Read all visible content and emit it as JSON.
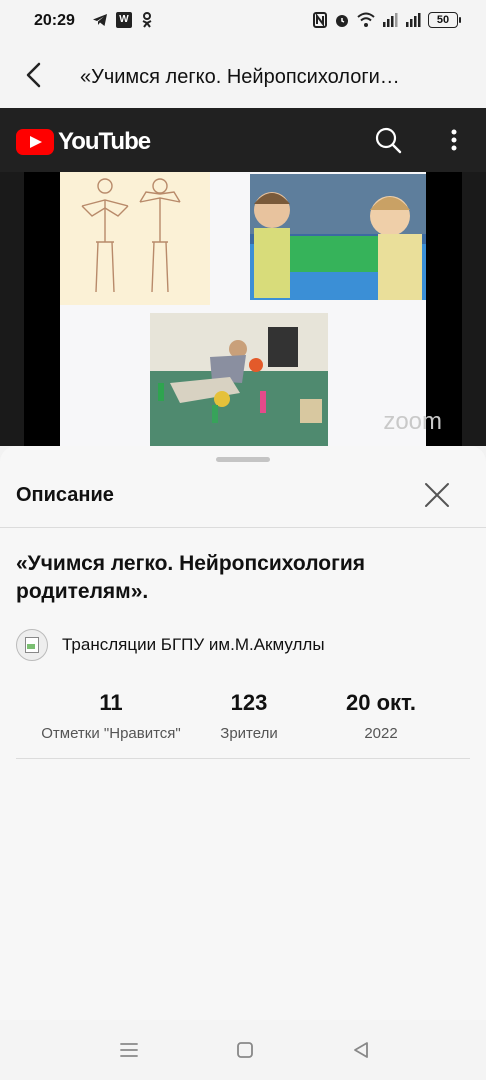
{
  "status": {
    "time": "20:29",
    "vk_label": "W",
    "battery": "50"
  },
  "appbar": {
    "title": "«Учимся легко. Нейропсихологи…"
  },
  "youtube": {
    "brand": "YouTube"
  },
  "video": {
    "watermark": "zoom"
  },
  "sheet": {
    "title": "Описание",
    "video_title": "«Учимся легко. Нейропсихология родителям».",
    "channel": "Трансляции БГПУ им.М.Акмуллы",
    "stats": [
      {
        "value": "11",
        "label": "Отметки \"Нравится\""
      },
      {
        "value": "123",
        "label": "Зрители"
      },
      {
        "value": "20 окт.",
        "label": "2022"
      }
    ]
  },
  "colors": {
    "youtube_red": "#ff0000",
    "youtube_bar": "#212121"
  }
}
